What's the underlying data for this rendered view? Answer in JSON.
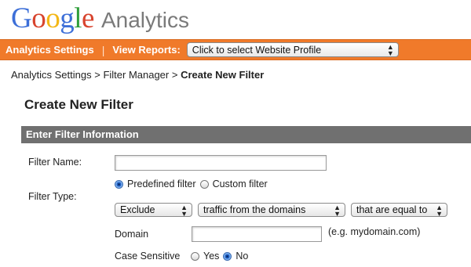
{
  "logo": {
    "letters": [
      "G",
      "o",
      "o",
      "g",
      "l",
      "e"
    ],
    "colors": [
      "#3d6fd8",
      "#d8442e",
      "#f3b716",
      "#3d6fd8",
      "#2f9e3a",
      "#d8442e"
    ],
    "product": "Analytics"
  },
  "navbar": {
    "settings_label": "Analytics Settings",
    "separator": "|",
    "reports_label": "View Reports:",
    "profile_select": "Click to select Website Profile",
    "color": "#f07a2a"
  },
  "breadcrumb": {
    "item1": "Analytics Settings",
    "sep": " > ",
    "item2": "Filter Manager",
    "current": "Create New Filter"
  },
  "page_title": "Create New Filter",
  "section_title": "Enter Filter Information",
  "form": {
    "filter_name_label": "Filter Name:",
    "filter_name_value": "",
    "filter_type_label": "Filter Type:",
    "predefined_label": "Predefined filter",
    "custom_label": "Custom filter",
    "predefined_checked": true,
    "type_select": "Exclude",
    "source_select": "traffic from the domains",
    "match_select": "that are equal to",
    "domain_label": "Domain",
    "domain_value": "",
    "domain_hint": "(e.g. mydomain.com)",
    "case_label": "Case Sensitive",
    "yes_label": "Yes",
    "no_label": "No",
    "case_no_checked": true
  }
}
